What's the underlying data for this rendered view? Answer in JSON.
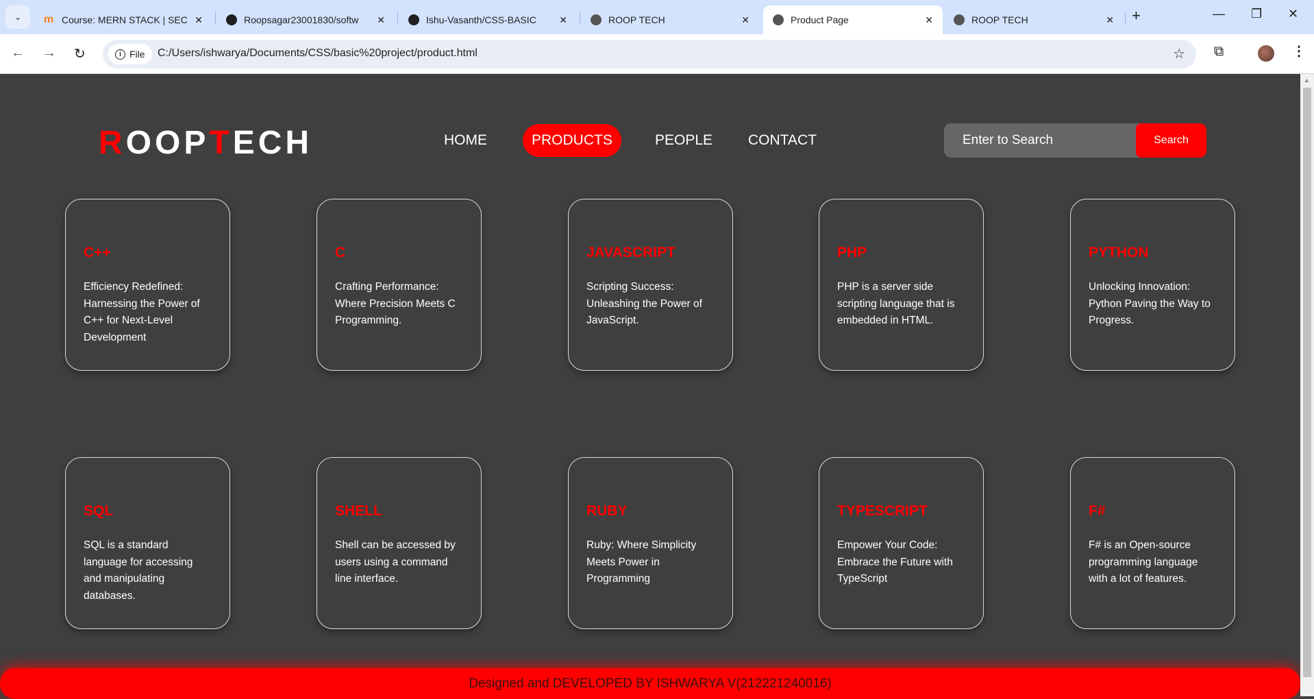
{
  "browser": {
    "tabs": [
      {
        "label": "Course: MERN STACK | SEC",
        "icon": "moodle-icon",
        "active": false
      },
      {
        "label": "Roopsagar23001830/softw",
        "icon": "github-icon",
        "active": false
      },
      {
        "label": "Ishu-Vasanth/CSS-BASIC",
        "icon": "github-icon",
        "active": false
      },
      {
        "label": "ROOP TECH",
        "icon": "globe-icon",
        "active": false
      },
      {
        "label": "Product Page",
        "icon": "globe-icon",
        "active": true
      },
      {
        "label": "ROOP TECH",
        "icon": "globe-icon",
        "active": false
      }
    ],
    "close_glyph": "✕",
    "site_chip": "File",
    "url": "C:/Users/ishwarya/Documents/CSS/basic%20project/product.html"
  },
  "site": {
    "logo": {
      "first": "R",
      "mid": "OOP",
      "second": "T",
      "rest": "ECH"
    },
    "nav": [
      {
        "label": "HOME",
        "active": false
      },
      {
        "label": "PRODUCTS",
        "active": true
      },
      {
        "label": "PEOPLE",
        "active": false
      },
      {
        "label": "CONTACT",
        "active": false
      }
    ],
    "search": {
      "placeholder": "Enter to Search",
      "button": "Search"
    },
    "cards": [
      {
        "title": "C++",
        "text": "Efficiency Redefined: Harnessing the Power of C++ for Next-Level Development"
      },
      {
        "title": "C",
        "text": "Crafting Performance: Where Precision Meets C Programming."
      },
      {
        "title": "JAVASCRIPT",
        "text": "Scripting Success: Unleashing the Power of JavaScript."
      },
      {
        "title": "PHP",
        "text": "PHP is a server side scripting language that is embedded in HTML."
      },
      {
        "title": "PYTHON",
        "text": "Unlocking Innovation: Python Paving the Way to Progress."
      },
      {
        "title": "SQL",
        "text": "SQL is a standard language for accessing and manipulating databases."
      },
      {
        "title": "SHELL",
        "text": "Shell can be accessed by users using a command line interface."
      },
      {
        "title": "RUBY",
        "text": "Ruby: Where Simplicity Meets Power in Programming"
      },
      {
        "title": "TYPESCRIPT",
        "text": "Empower Your Code: Embrace the Future with TypeScript"
      },
      {
        "title": "F#",
        "text": "F# is an Open-source programming language with a lot of features."
      }
    ],
    "footer": "Designed and DEVELOPED BY ISHWARYA V(212221240016)"
  },
  "colors": {
    "accent": "#ff0000",
    "background": "#3f3f3f"
  }
}
